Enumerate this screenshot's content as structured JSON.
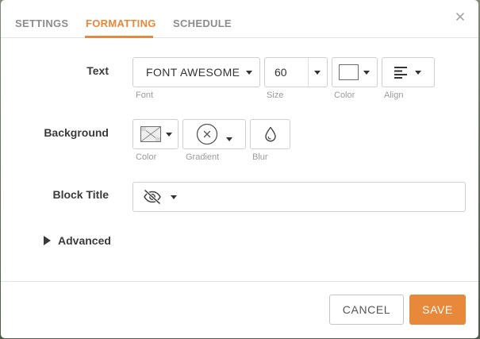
{
  "tabs": [
    {
      "label": "SETTINGS",
      "active": false
    },
    {
      "label": "FORMATTING",
      "active": true
    },
    {
      "label": "SCHEDULE",
      "active": false
    }
  ],
  "accent_color": "#e8883a",
  "text_row": {
    "label": "Text",
    "font": {
      "value": "FONT AWESOME",
      "caption": "Font"
    },
    "size": {
      "value": "60",
      "caption": "Size"
    },
    "color": {
      "value": "#ffffff",
      "caption": "Color"
    },
    "align": {
      "icon": "align-left-icon",
      "caption": "Align"
    }
  },
  "background_row": {
    "label": "Background",
    "color": {
      "icon": "no-color-swatch-icon",
      "caption": "Color"
    },
    "gradient": {
      "icon": "circle-x-icon",
      "caption": "Gradient"
    },
    "blur": {
      "icon": "droplet-icon",
      "caption": "Blur"
    }
  },
  "block_title_row": {
    "label": "Block Title",
    "visibility_icon": "eye-slash-icon",
    "value": ""
  },
  "advanced": {
    "label": "Advanced",
    "expanded": false
  },
  "footer": {
    "cancel_label": "CANCEL",
    "save_label": "SAVE"
  }
}
